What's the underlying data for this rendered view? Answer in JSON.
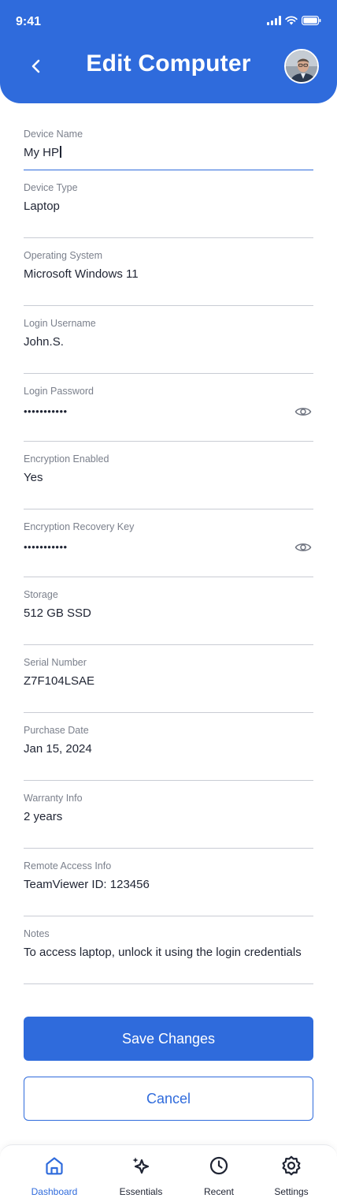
{
  "status_bar": {
    "time": "9:41"
  },
  "header": {
    "title": "Edit Computer"
  },
  "colors": {
    "accent": "#2f6bdc",
    "text": "#1f2433",
    "label": "#7b808c",
    "divider": "#c9ccd4"
  },
  "fields": [
    {
      "label": "Device Name",
      "value": "My HP"
    },
    {
      "label": "Device Type",
      "value": "Laptop"
    },
    {
      "label": "Operating System",
      "value": "Microsoft Windows 11"
    },
    {
      "label": "Login Username",
      "value": "John.S."
    },
    {
      "label": "Login Password",
      "value": "•••••••••••"
    },
    {
      "label": "Encryption Enabled",
      "value": "Yes"
    },
    {
      "label": "Encryption Recovery Key",
      "value": "•••••••••••"
    },
    {
      "label": "Storage",
      "value": "512 GB SSD"
    },
    {
      "label": "Serial Number",
      "value": "Z7F104LSAE"
    },
    {
      "label": "Purchase Date",
      "value": "Jan 15, 2024"
    },
    {
      "label": "Warranty Info",
      "value": "2 years"
    },
    {
      "label": "Remote Access Info",
      "value": "TeamViewer ID: 123456"
    },
    {
      "label": "Notes",
      "value": "To access laptop, unlock it using the login credentials"
    }
  ],
  "buttons": {
    "save": "Save Changes",
    "cancel": "Cancel"
  },
  "tabs": [
    {
      "label": "Dashboard",
      "icon": "home-icon",
      "active": true
    },
    {
      "label": "Essentials",
      "icon": "sparkle-icon",
      "active": false
    },
    {
      "label": "Recent",
      "icon": "clock-icon",
      "active": false
    },
    {
      "label": "Settings",
      "icon": "gear-icon",
      "active": false
    }
  ]
}
